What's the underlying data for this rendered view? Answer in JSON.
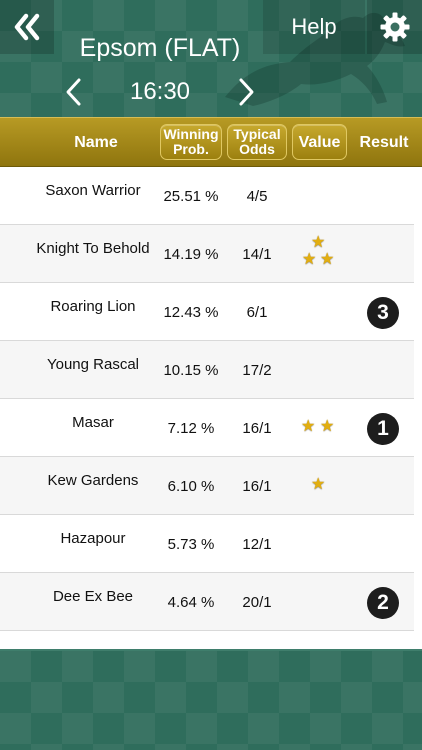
{
  "header": {
    "help_label": "Help",
    "race_title": "Epsom (FLAT)",
    "race_time": "16:30"
  },
  "columns": {
    "name": "Name",
    "prob_line1": "Winning",
    "prob_line2": "Prob.",
    "odds_line1": "Typical",
    "odds_line2": "Odds",
    "value": "Value",
    "result": "Result"
  },
  "runners": [
    {
      "name": "Saxon Warrior",
      "prob": "25.51 %",
      "odds": "4/5",
      "value_stars": 0,
      "result": ""
    },
    {
      "name": "Knight To Behold",
      "prob": "14.19 %",
      "odds": "14/1",
      "value_stars": 3,
      "result": ""
    },
    {
      "name": "Roaring Lion",
      "prob": "12.43 %",
      "odds": "6/1",
      "value_stars": 0,
      "result": "3"
    },
    {
      "name": "Young Rascal",
      "prob": "10.15 %",
      "odds": "17/2",
      "value_stars": 0,
      "result": ""
    },
    {
      "name": "Masar",
      "prob": "7.12 %",
      "odds": "16/1",
      "value_stars": 2,
      "result": "1"
    },
    {
      "name": "Kew Gardens",
      "prob": "6.10 %",
      "odds": "16/1",
      "value_stars": 1,
      "result": ""
    },
    {
      "name": "Hazapour",
      "prob": "5.73 %",
      "odds": "12/1",
      "value_stars": 0,
      "result": ""
    },
    {
      "name": "Dee Ex Bee",
      "prob": "4.64 %",
      "odds": "20/1",
      "value_stars": 0,
      "result": "2"
    }
  ],
  "icons": {
    "back": "double-chevron-left-icon",
    "settings": "gear-icon",
    "prev": "chevron-left-icon",
    "next": "chevron-right-icon",
    "value": "star-icon"
  },
  "colors": {
    "background": "#2f6d5c",
    "header_bar": "#a88b1c",
    "star": "#e2ae10",
    "result_badge": "#1d1d1d"
  }
}
